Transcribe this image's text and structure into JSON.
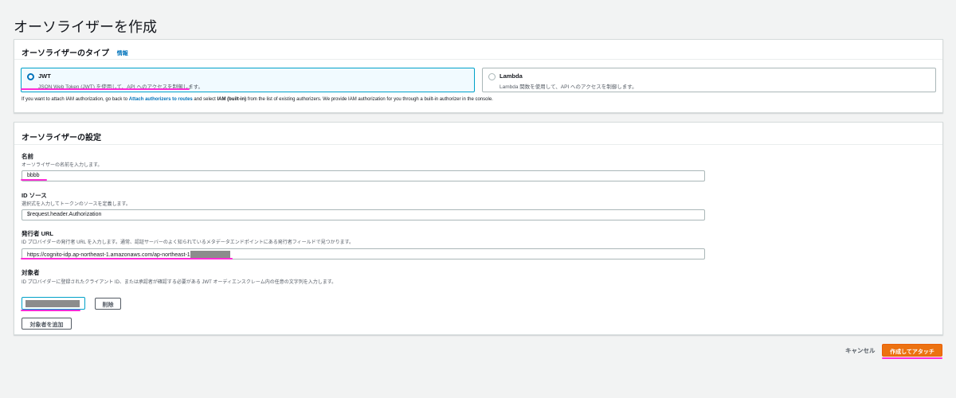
{
  "page": {
    "title": "オーソライザーを作成"
  },
  "type_panel": {
    "header": "オーソライザーのタイプ",
    "info_link": "情報",
    "options": [
      {
        "title": "JWT",
        "description": "JSON Web Token (JWT) を使用して、API へのアクセスを制御します。",
        "selected": true
      },
      {
        "title": "Lambda",
        "description": "Lambda 関数を使用して、API へのアクセスを制御します。",
        "selected": false
      }
    ],
    "note": {
      "before": "If you want to attach IAM authorization, go back to ",
      "link": "Attach authorizers to routes",
      "middle": " and select ",
      "bold": "IAM (built-in)",
      "after": " from the list of existing authorizers. We provide IAM authorization for you through a built-in authorizer in the console."
    }
  },
  "settings_panel": {
    "header": "オーソライザーの設定",
    "name": {
      "label": "名前",
      "description": "オーソライザーの名前を入力します。",
      "value": "bbbb"
    },
    "identity_source": {
      "label": "ID ソース",
      "description": "選択式を入力してトークンのソースを定義します。",
      "value": "$request.header.Authorization"
    },
    "issuer_url": {
      "label": "発行者 URL",
      "description": "ID プロバイダーの発行者 URL を入力します。通常、認証サーバーのよく知られているメタデータエンドポイントにある発行者フィールドで見つかります。",
      "value": "https://cognito-idp.ap-northeast-1.amazonaws.com/ap-northeast-1"
    },
    "audience": {
      "label": "対象者",
      "description": "ID プロバイダーに登録されたクライアント ID、または承認者が確認する必要がある JWT オーディエンスクレーム内の任意の文字列を入力します。",
      "delete_label": "削除",
      "add_label": "対象者を追加"
    }
  },
  "footer": {
    "cancel_label": "キャンセル",
    "create_label": "作成してアタッチ"
  },
  "colors": {
    "primary": "#ec7211",
    "link": "#0073bb",
    "highlight": "#ff2bd6"
  }
}
